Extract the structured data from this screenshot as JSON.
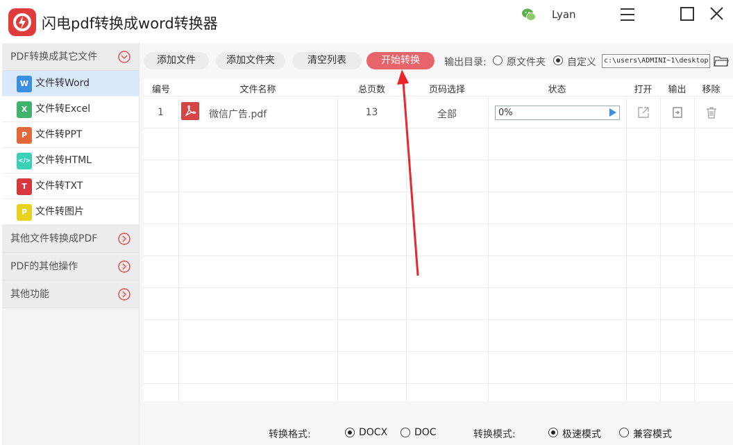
{
  "app": {
    "title": "闪电pdf转换成word转换器",
    "user_name": "Lyan"
  },
  "sidebar": {
    "sections": [
      {
        "label": "PDF转换成其它文件"
      },
      {
        "label": "其他文件转换成PDF"
      },
      {
        "label": "PDF的其他操作"
      },
      {
        "label": "其他功能"
      }
    ],
    "items": [
      {
        "label": "文件转Word",
        "icon_text": "W",
        "color": "#3b8fe0"
      },
      {
        "label": "文件转Excel",
        "icon_text": "X",
        "color": "#3fb26d"
      },
      {
        "label": "文件转PPT",
        "icon_text": "P",
        "color": "#e2683c"
      },
      {
        "label": "文件转HTML",
        "icon_text": "</>",
        "color": "#3ccfb7"
      },
      {
        "label": "文件转TXT",
        "icon_text": "T",
        "color": "#d7383f"
      },
      {
        "label": "文件转图片",
        "icon_text": "P",
        "color": "#e8d21f"
      }
    ]
  },
  "toolbar": {
    "add_file": "添加文件",
    "add_folder": "添加文件夹",
    "clear_list": "清空列表",
    "start": "开始转换",
    "output_label": "输出目录:",
    "opt_source": "原文件夹",
    "opt_custom": "自定义",
    "path": "c:\\users\\ADMINI~1\\desktop"
  },
  "table": {
    "headers": [
      "编号",
      "文件名称",
      "总页数",
      "页码选择",
      "状态",
      "打开",
      "输出",
      "移除"
    ],
    "rows": [
      {
        "index": "1",
        "name": "微信广告.pdf",
        "pages": "13",
        "range": "全部",
        "status": "0%"
      }
    ]
  },
  "bottom": {
    "format_label": "转换格式:",
    "format_docx": "DOCX",
    "format_doc": "DOC",
    "mode_label": "转换模式:",
    "mode_fast": "极速模式",
    "mode_compat": "兼容模式"
  },
  "colors": {
    "accent": "#e8646b",
    "active_item": "#d9e9fb",
    "annotation": "#e8262b"
  }
}
